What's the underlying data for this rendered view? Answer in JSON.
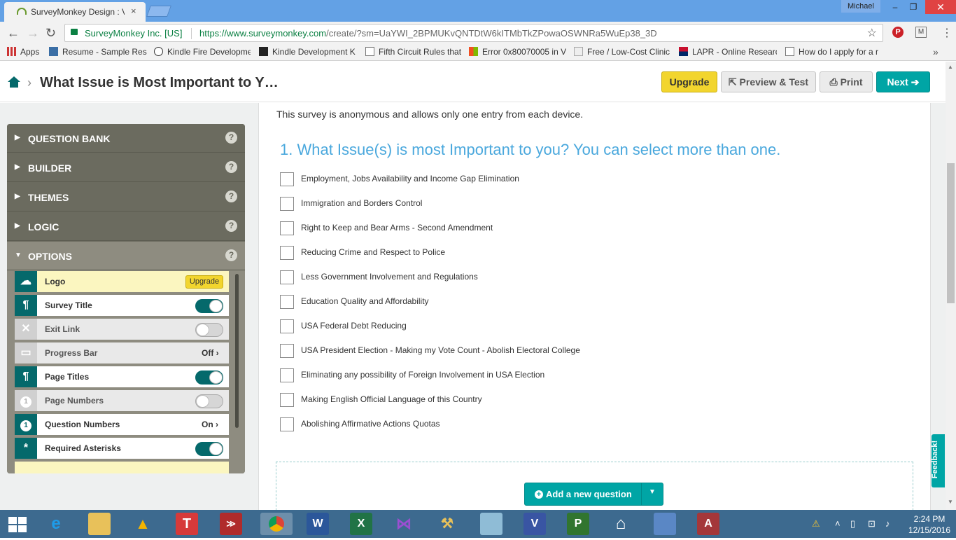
{
  "browser": {
    "tab_title": "SurveyMonkey Design : V",
    "tab_close": "×",
    "user": "Michael",
    "window_buttons": [
      "–",
      "❐",
      "✕"
    ],
    "secure_label": "SurveyMonkey Inc. [US]",
    "url_host": "https://www.surveymonkey.com",
    "url_path": "/create/?sm=UaYWI_2BPMUKvQNTDtW6kITMbTkZPowaOSWNRa5WuEp38_3D",
    "star": "☆",
    "extensions": [
      "P",
      "M"
    ],
    "menu": "⋮",
    "bookmarks": [
      {
        "label": "Apps",
        "icon": "apps-grid-icon"
      },
      {
        "label": "Resume - Sample Res",
        "icon": "resume-icon"
      },
      {
        "label": "Kindle Fire Developme",
        "icon": "amazon-icon"
      },
      {
        "label": "Kindle Development K",
        "icon": "kindle-icon"
      },
      {
        "label": "Fifth Circuit Rules that",
        "icon": "page-icon"
      },
      {
        "label": "Error 0x80070005 in V",
        "icon": "windows-icon"
      },
      {
        "label": "Free / Low-Cost Clinic",
        "icon": "clinic-icon"
      },
      {
        "label": "LAPR - Online Researc",
        "icon": "arizona-flag-icon"
      },
      {
        "label": "How do I apply for a r",
        "icon": "page-icon"
      }
    ],
    "bookmarks_more": "»"
  },
  "header": {
    "breadcrumb_sep": "›",
    "title": "What Issue is Most Important to Y…",
    "upgrade": "Upgrade",
    "preview": "Preview & Test",
    "print": "Print",
    "next": "Next"
  },
  "left_panel": {
    "sections": [
      {
        "label": "QUESTION BANK",
        "arrow": "▶"
      },
      {
        "label": "BUILDER",
        "arrow": "▶"
      },
      {
        "label": "THEMES",
        "arrow": "▶"
      },
      {
        "label": "LOGIC",
        "arrow": "▶"
      },
      {
        "label": "OPTIONS",
        "arrow": "▼"
      }
    ],
    "help": "?",
    "options": [
      {
        "label": "Logo",
        "control": "upgrade",
        "control_label": "Upgrade",
        "enabled": true
      },
      {
        "label": "Survey Title",
        "control": "toggle",
        "on": true,
        "enabled": true
      },
      {
        "label": "Exit Link",
        "control": "toggle",
        "on": false,
        "enabled": false
      },
      {
        "label": "Progress Bar",
        "control": "text",
        "control_label": "Off",
        "enabled": false
      },
      {
        "label": "Page Titles",
        "control": "toggle",
        "on": true,
        "enabled": true
      },
      {
        "label": "Page Numbers",
        "control": "toggle",
        "on": false,
        "enabled": false
      },
      {
        "label": "Question Numbers",
        "control": "text",
        "control_label": "On",
        "enabled": true
      },
      {
        "label": "Required Asterisks",
        "control": "toggle",
        "on": true,
        "enabled": true
      }
    ]
  },
  "survey": {
    "intro": "This survey is anonymous and allows only one entry from each device.",
    "question": "1. What Issue(s) is most Important to you? You can select more than one.",
    "choices": [
      "Employment, Jobs Availability and Income Gap Elimination",
      "Immigration and Borders Control",
      "Right to Keep and Bear Arms - Second Amendment",
      "Reducing Crime and Respect to Police",
      "Less Government Involvement and Regulations",
      "Education Quality and Affordability",
      "USA Federal Debt Reducing",
      "USA President Election - Making my Vote Count - Abolish Electoral College",
      "Eliminating any possibility of Foreign Involvement in USA Election",
      "Making English Official Language of this Country",
      "Abolishing Affirmative Actions Quotas"
    ],
    "add_question": "Add a new question",
    "feedback": "Feedback!"
  },
  "taskbar": {
    "time": "2:24 PM",
    "date": "12/15/2016"
  }
}
